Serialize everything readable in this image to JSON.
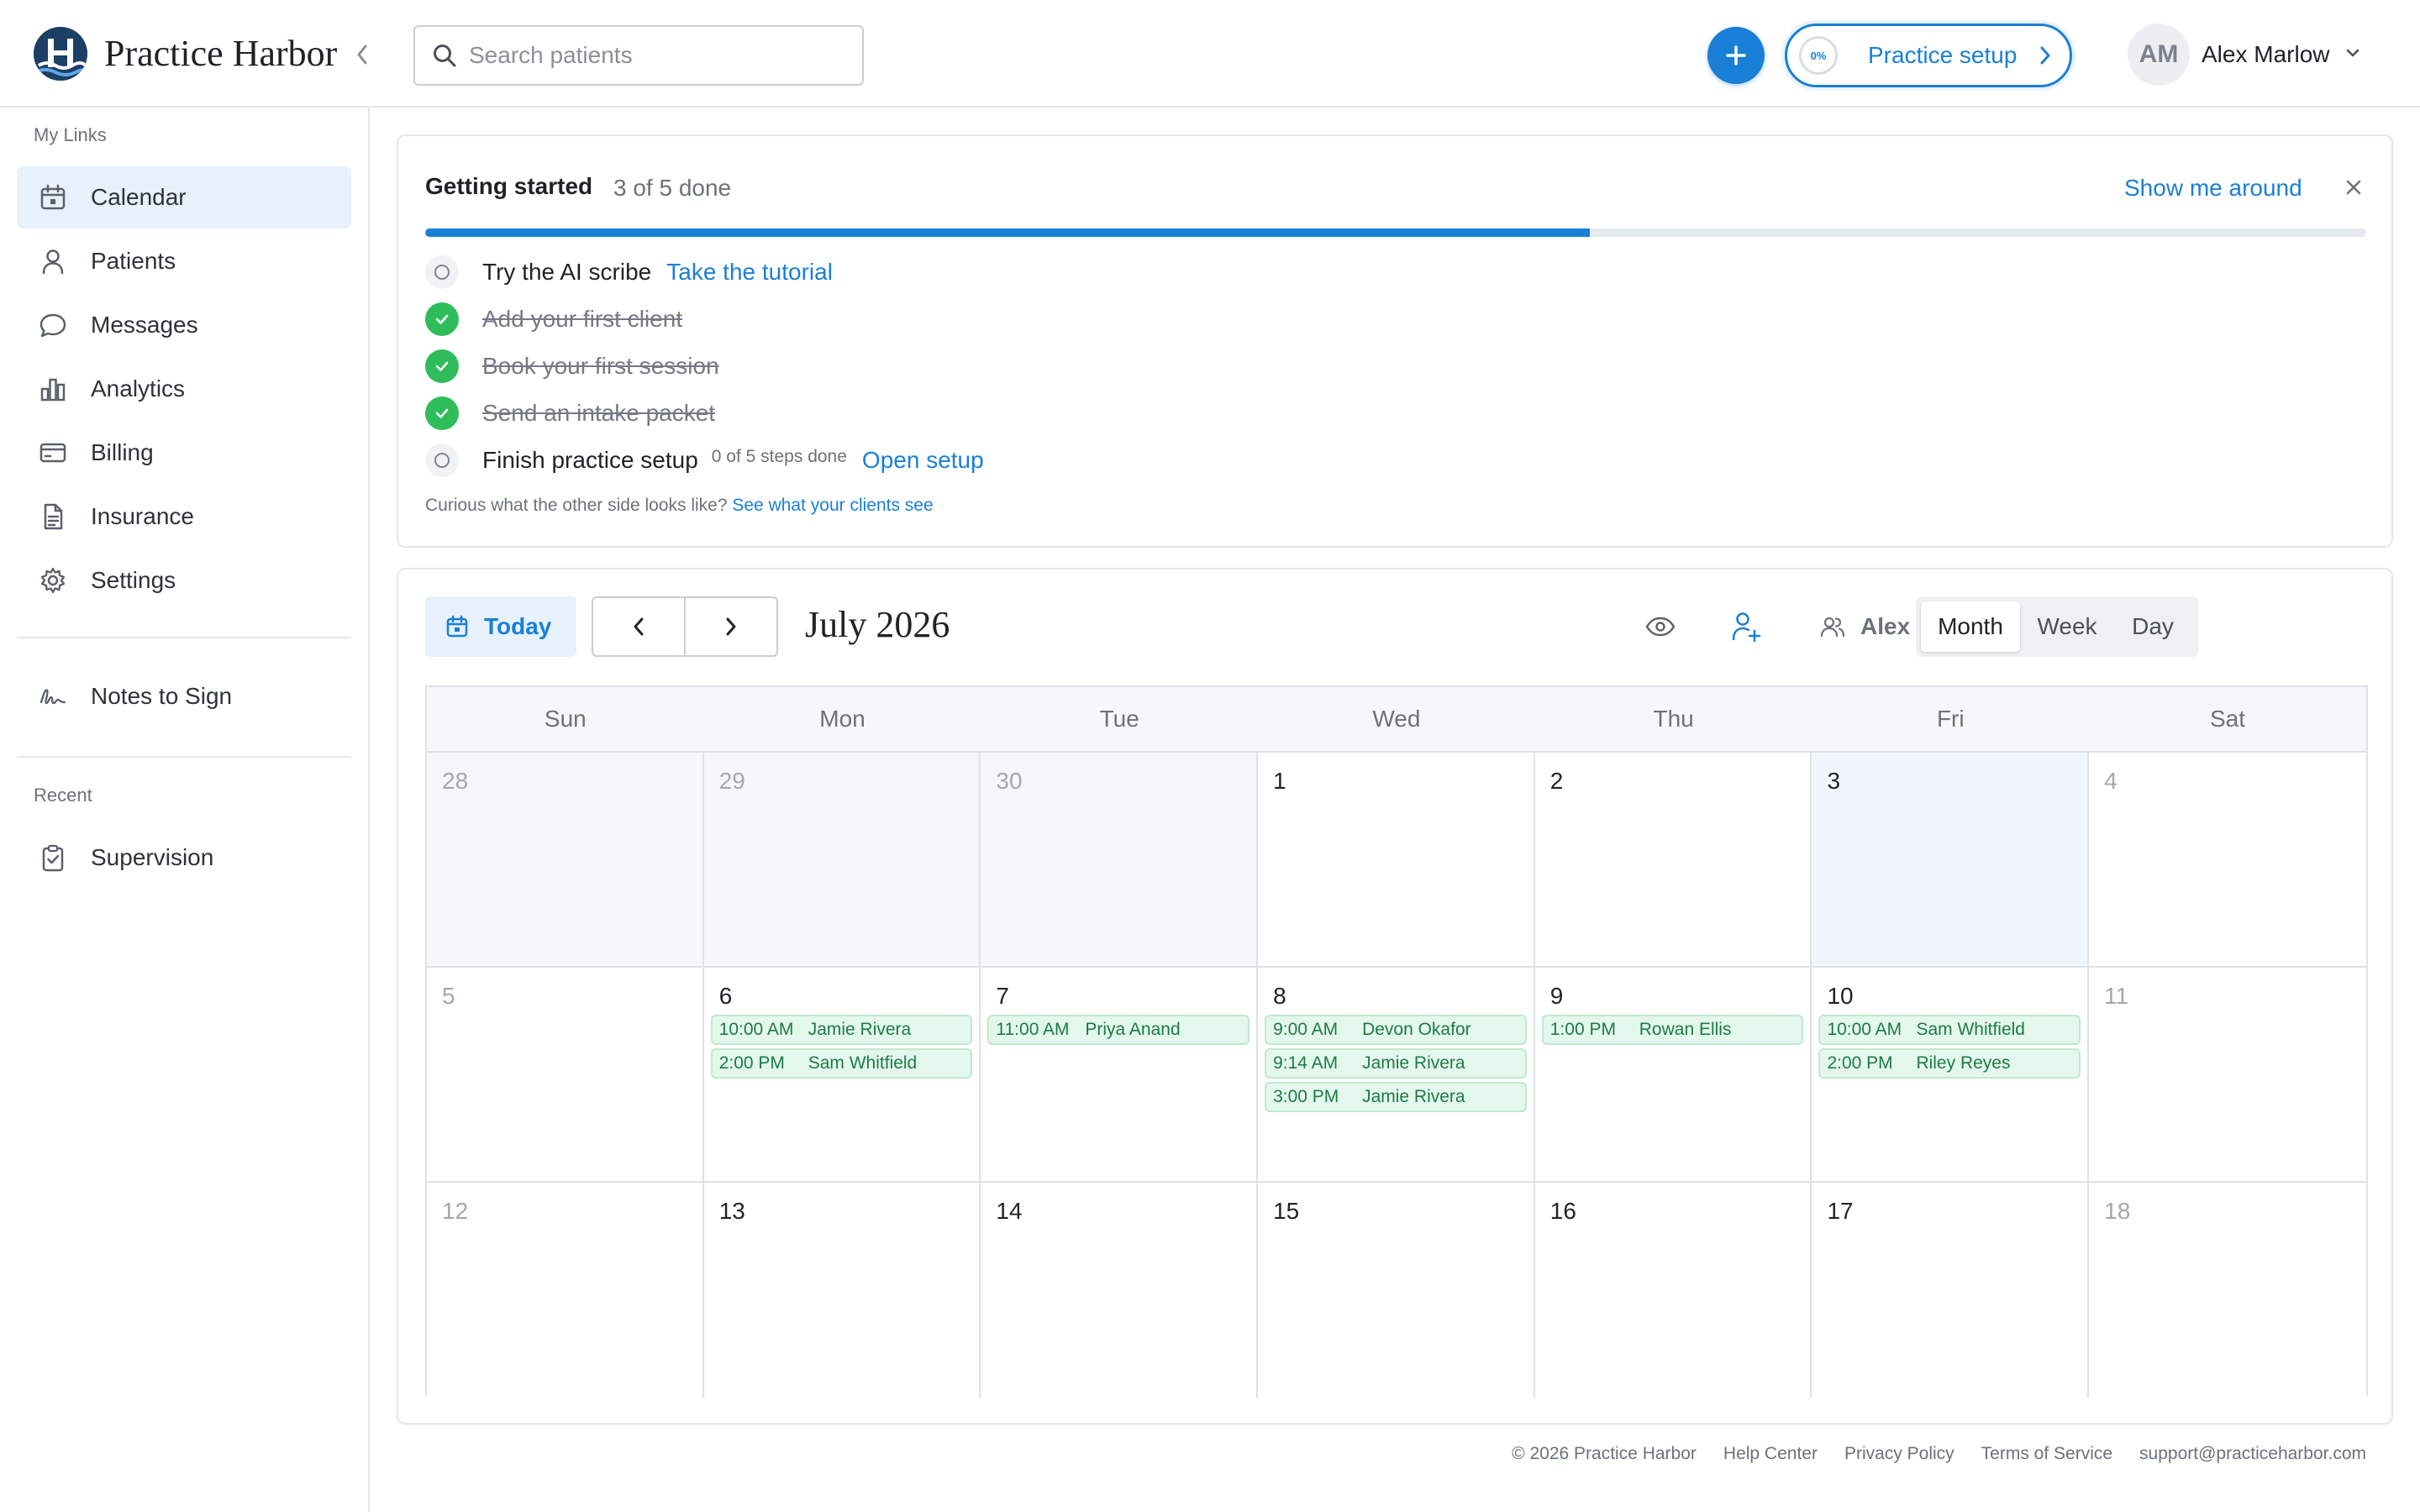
{
  "app": {
    "brand": "Practice Harbor",
    "colors": {
      "accent": "#1a7fd6",
      "success": "#2ebd5a",
      "event_bg": "#e4f7ec",
      "event_text": "#1c7c45"
    }
  },
  "header": {
    "search_placeholder": "Search patients",
    "setup_progress": "0%",
    "setup_label": "Practice setup",
    "user_initials": "AM",
    "user_name": "Alex Marlow"
  },
  "sidebar": {
    "my_links_heading": "My Links",
    "items": [
      {
        "label": "Calendar",
        "icon": "calendar-icon"
      },
      {
        "label": "Patients",
        "icon": "person-icon"
      },
      {
        "label": "Messages",
        "icon": "chat-bubble-icon"
      },
      {
        "label": "Analytics",
        "icon": "bar-chart-icon"
      },
      {
        "label": "Billing",
        "icon": "credit-card-icon"
      },
      {
        "label": "Insurance",
        "icon": "document-icon"
      },
      {
        "label": "Settings",
        "icon": "gear-icon"
      }
    ],
    "notes_to_sign": "Notes to Sign",
    "recent_heading": "Recent",
    "recent_items": [
      {
        "label": "Supervision",
        "icon": "clipboard-check-icon"
      }
    ]
  },
  "getting_started": {
    "title": "Getting started",
    "count": "3 of 5 done",
    "progress_fraction": 0.6,
    "show_me_around": "Show me around",
    "tasks": [
      {
        "label": "Try the AI scribe",
        "done": false,
        "link": "Take the tutorial",
        "sub": ""
      },
      {
        "label": "Add your first client",
        "done": true,
        "link": "",
        "sub": ""
      },
      {
        "label": "Book your first session",
        "done": true,
        "link": "",
        "sub": ""
      },
      {
        "label": "Send an intake packet",
        "done": true,
        "link": "",
        "sub": ""
      },
      {
        "label": "Finish practice setup",
        "done": false,
        "link": "Open setup",
        "sub": "0 of 5 steps done"
      }
    ],
    "footer_text": "Curious what the other side looks like?",
    "footer_link": "See what your clients see"
  },
  "calendar": {
    "today_label": "Today",
    "month_title": "July 2026",
    "provider": "Alex Marlow",
    "views": [
      "Month",
      "Week",
      "Day"
    ],
    "active_view": "Month",
    "weekdays": [
      "Sun",
      "Mon",
      "Tue",
      "Wed",
      "Thu",
      "Fri",
      "Sat"
    ],
    "weeks": [
      [
        {
          "day": "28",
          "muted": true,
          "faded": true,
          "events": []
        },
        {
          "day": "29",
          "muted": true,
          "faded": true,
          "events": []
        },
        {
          "day": "30",
          "muted": true,
          "faded": true,
          "events": []
        },
        {
          "day": "1",
          "events": []
        },
        {
          "day": "2",
          "events": []
        },
        {
          "day": "3",
          "highlight": true,
          "events": []
        },
        {
          "day": "4",
          "faded": true,
          "events": []
        }
      ],
      [
        {
          "day": "5",
          "faded": true,
          "events": []
        },
        {
          "day": "6",
          "events": [
            {
              "time": "10:00 AM",
              "name": "Jamie Rivera"
            },
            {
              "time": "2:00 PM",
              "name": "Sam Whitfield"
            }
          ]
        },
        {
          "day": "7",
          "events": [
            {
              "time": "11:00 AM",
              "name": "Priya Anand"
            }
          ]
        },
        {
          "day": "8",
          "events": [
            {
              "time": "9:00 AM",
              "name": "Devon Okafor"
            },
            {
              "time": "9:14 AM",
              "name": "Jamie Rivera"
            },
            {
              "time": "3:00 PM",
              "name": "Jamie Rivera"
            }
          ]
        },
        {
          "day": "9",
          "events": [
            {
              "time": "1:00 PM",
              "name": "Rowan Ellis"
            }
          ]
        },
        {
          "day": "10",
          "events": [
            {
              "time": "10:00 AM",
              "name": "Sam Whitfield"
            },
            {
              "time": "2:00 PM",
              "name": "Riley Reyes"
            }
          ]
        },
        {
          "day": "11",
          "faded": true,
          "events": []
        }
      ],
      [
        {
          "day": "12",
          "faded": true,
          "events": []
        },
        {
          "day": "13",
          "events": []
        },
        {
          "day": "14",
          "events": []
        },
        {
          "day": "15",
          "events": []
        },
        {
          "day": "16",
          "events": []
        },
        {
          "day": "17",
          "events": []
        },
        {
          "day": "18",
          "faded": true,
          "events": []
        }
      ]
    ]
  },
  "footer": {
    "copyright": "© 2026 Practice Harbor",
    "links": [
      "Help Center",
      "Privacy Policy",
      "Terms of Service",
      "support@practiceharbor.com"
    ]
  }
}
